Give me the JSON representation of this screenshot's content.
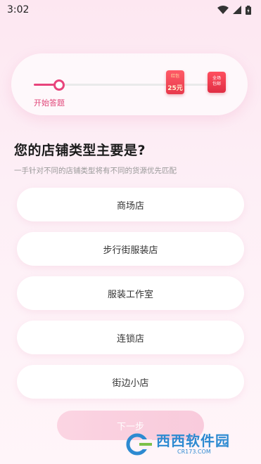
{
  "status_bar": {
    "time": "3:02"
  },
  "progress": {
    "start_label": "开始答题",
    "progress_fraction": 0.14,
    "reward_redpacket": {
      "top_label": "红包",
      "amount": "25元"
    },
    "reward_shipping": {
      "line1": "全场",
      "line2": "包邮"
    }
  },
  "question": {
    "title": "您的店铺类型主要是?",
    "subtitle": "一手针对不同的店铺类型将有不同的货源优先匹配"
  },
  "options": [
    {
      "label": "商场店"
    },
    {
      "label": "步行街服装店"
    },
    {
      "label": "服装工作室"
    },
    {
      "label": "连锁店"
    },
    {
      "label": "街边小店"
    }
  ],
  "next_button": {
    "label": "下一步"
  },
  "watermark": {
    "name": "西西软件园",
    "url": "CR173.COM"
  },
  "colors": {
    "accent": "#e8447c",
    "background": "#fde7f1"
  }
}
